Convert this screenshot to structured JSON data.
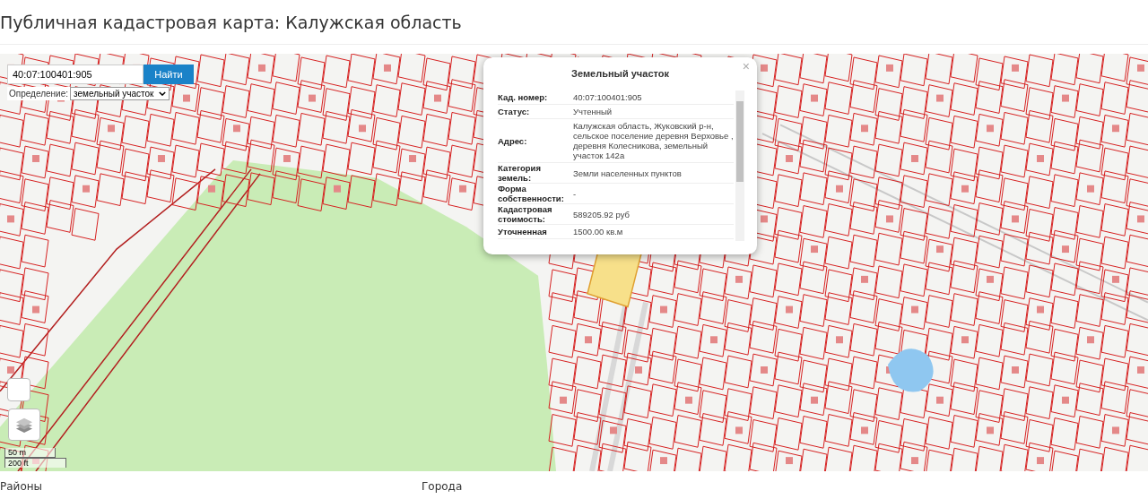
{
  "page": {
    "title": "Публичная кадастровая карта: Калужская область"
  },
  "search": {
    "value": "40:07:100401:905",
    "button": "Найти"
  },
  "mode": {
    "label": "Определение:",
    "value": "земельный участок"
  },
  "popup": {
    "title": "Земельный участок",
    "close": "×",
    "rows": [
      {
        "label": "Кад. номер:",
        "value": "40:07:100401:905"
      },
      {
        "label": "Статус:",
        "value": "Учтенный"
      },
      {
        "label": "Адрес:",
        "value": "Калужская область, Жуковский р-н, сельское поселение деревня Верховье , деревня Колесникова, земельный участок 142а"
      },
      {
        "label": "Категория земель:",
        "value": "Земли населенных пунктов"
      },
      {
        "label": "Форма собственности:",
        "value": "-"
      },
      {
        "label": "Кадастровая стоимость:",
        "value": "589205.92 руб"
      },
      {
        "label": "Уточненная",
        "value": "1500.00 кв.м"
      }
    ]
  },
  "scale": {
    "metric": "50 m",
    "imperial": "200 ft"
  },
  "footer": {
    "columns": [
      "Районы",
      "Города"
    ]
  }
}
